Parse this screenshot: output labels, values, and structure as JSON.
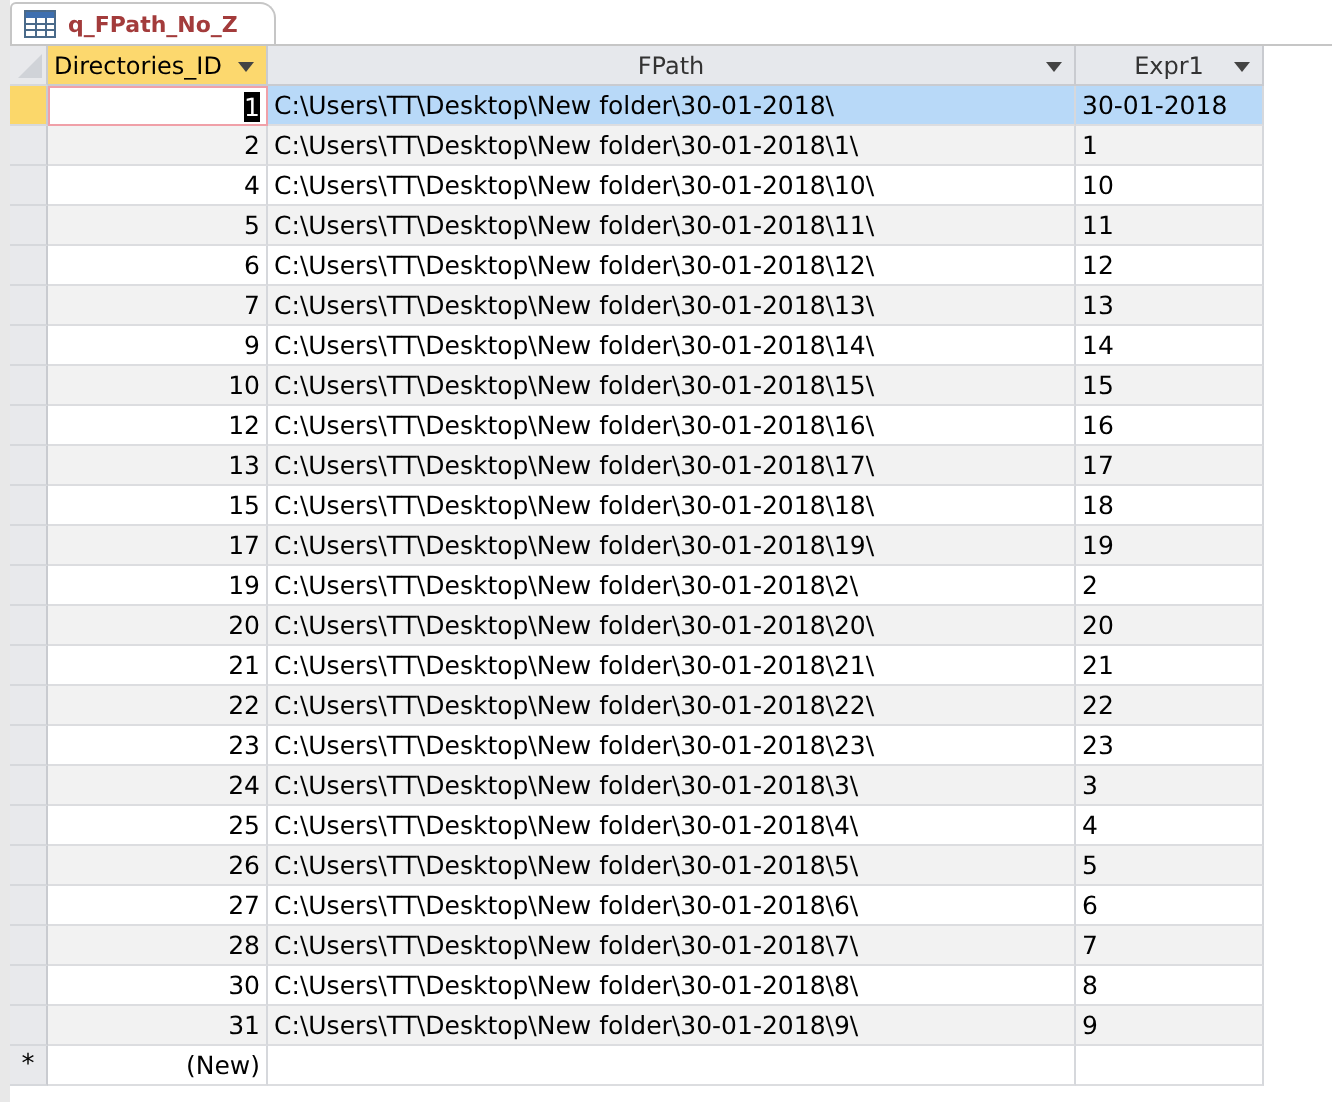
{
  "tab": {
    "title": "q_FPath_No_Z",
    "selected": true
  },
  "columns": [
    {
      "label": "Directories_ID",
      "selected": true
    },
    {
      "label": "FPath",
      "selected": false
    },
    {
      "label": "Expr1",
      "selected": false
    }
  ],
  "rows": [
    {
      "id": "1",
      "fpath": "C:\\Users\\TT\\Desktop\\New folder\\30-01-2018\\",
      "expr1": "30-01-2018",
      "selected": true
    },
    {
      "id": "2",
      "fpath": "C:\\Users\\TT\\Desktop\\New folder\\30-01-2018\\1\\",
      "expr1": "1",
      "selected": false
    },
    {
      "id": "4",
      "fpath": "C:\\Users\\TT\\Desktop\\New folder\\30-01-2018\\10\\",
      "expr1": "10",
      "selected": false
    },
    {
      "id": "5",
      "fpath": "C:\\Users\\TT\\Desktop\\New folder\\30-01-2018\\11\\",
      "expr1": "11",
      "selected": false
    },
    {
      "id": "6",
      "fpath": "C:\\Users\\TT\\Desktop\\New folder\\30-01-2018\\12\\",
      "expr1": "12",
      "selected": false
    },
    {
      "id": "7",
      "fpath": "C:\\Users\\TT\\Desktop\\New folder\\30-01-2018\\13\\",
      "expr1": "13",
      "selected": false
    },
    {
      "id": "9",
      "fpath": "C:\\Users\\TT\\Desktop\\New folder\\30-01-2018\\14\\",
      "expr1": "14",
      "selected": false
    },
    {
      "id": "10",
      "fpath": "C:\\Users\\TT\\Desktop\\New folder\\30-01-2018\\15\\",
      "expr1": "15",
      "selected": false
    },
    {
      "id": "12",
      "fpath": "C:\\Users\\TT\\Desktop\\New folder\\30-01-2018\\16\\",
      "expr1": "16",
      "selected": false
    },
    {
      "id": "13",
      "fpath": "C:\\Users\\TT\\Desktop\\New folder\\30-01-2018\\17\\",
      "expr1": "17",
      "selected": false
    },
    {
      "id": "15",
      "fpath": "C:\\Users\\TT\\Desktop\\New folder\\30-01-2018\\18\\",
      "expr1": "18",
      "selected": false
    },
    {
      "id": "17",
      "fpath": "C:\\Users\\TT\\Desktop\\New folder\\30-01-2018\\19\\",
      "expr1": "19",
      "selected": false
    },
    {
      "id": "19",
      "fpath": "C:\\Users\\TT\\Desktop\\New folder\\30-01-2018\\2\\",
      "expr1": "2",
      "selected": false
    },
    {
      "id": "20",
      "fpath": "C:\\Users\\TT\\Desktop\\New folder\\30-01-2018\\20\\",
      "expr1": "20",
      "selected": false
    },
    {
      "id": "21",
      "fpath": "C:\\Users\\TT\\Desktop\\New folder\\30-01-2018\\21\\",
      "expr1": "21",
      "selected": false
    },
    {
      "id": "22",
      "fpath": "C:\\Users\\TT\\Desktop\\New folder\\30-01-2018\\22\\",
      "expr1": "22",
      "selected": false
    },
    {
      "id": "23",
      "fpath": "C:\\Users\\TT\\Desktop\\New folder\\30-01-2018\\23\\",
      "expr1": "23",
      "selected": false
    },
    {
      "id": "24",
      "fpath": "C:\\Users\\TT\\Desktop\\New folder\\30-01-2018\\3\\",
      "expr1": "3",
      "selected": false
    },
    {
      "id": "25",
      "fpath": "C:\\Users\\TT\\Desktop\\New folder\\30-01-2018\\4\\",
      "expr1": "4",
      "selected": false
    },
    {
      "id": "26",
      "fpath": "C:\\Users\\TT\\Desktop\\New folder\\30-01-2018\\5\\",
      "expr1": "5",
      "selected": false
    },
    {
      "id": "27",
      "fpath": "C:\\Users\\TT\\Desktop\\New folder\\30-01-2018\\6\\",
      "expr1": "6",
      "selected": false
    },
    {
      "id": "28",
      "fpath": "C:\\Users\\TT\\Desktop\\New folder\\30-01-2018\\7\\",
      "expr1": "7",
      "selected": false
    },
    {
      "id": "30",
      "fpath": "C:\\Users\\TT\\Desktop\\New folder\\30-01-2018\\8\\",
      "expr1": "8",
      "selected": false
    },
    {
      "id": "31",
      "fpath": "C:\\Users\\TT\\Desktop\\New folder\\30-01-2018\\9\\",
      "expr1": "9",
      "selected": false
    }
  ],
  "new_row": {
    "marker": "*",
    "id": "(New)"
  }
}
